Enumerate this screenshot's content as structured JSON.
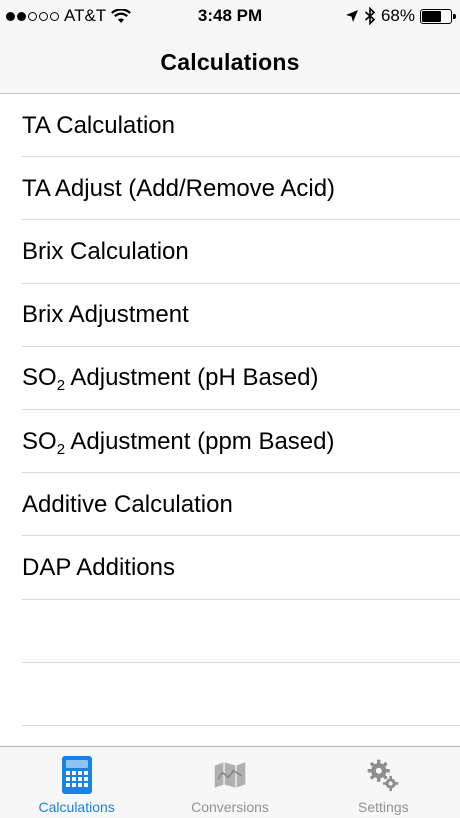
{
  "status_bar": {
    "carrier": "AT&T",
    "time": "3:48 PM",
    "battery": "68%",
    "battery_level": 0.68
  },
  "nav": {
    "title": "Calculations"
  },
  "list": [
    {
      "label": "TA Calculation"
    },
    {
      "label": "TA Adjust (Add/Remove Acid)"
    },
    {
      "label": "Brix Calculation"
    },
    {
      "label": "Brix Adjustment"
    },
    {
      "pre": "SO",
      "sub": "2",
      "post": " Adjustment (pH Based)"
    },
    {
      "pre": "SO",
      "sub": "2",
      "post": " Adjustment (ppm Based)"
    },
    {
      "label": "Additive Calculation"
    },
    {
      "label": "DAP Additions"
    }
  ],
  "tabs": [
    {
      "label": "Calculations",
      "icon": "calculator-icon",
      "active": true
    },
    {
      "label": "Conversions",
      "icon": "map-icon",
      "active": false
    },
    {
      "label": "Settings",
      "icon": "gears-icon",
      "active": false
    }
  ],
  "colors": {
    "accent": "#1a82e2",
    "inactive": "#929292"
  }
}
